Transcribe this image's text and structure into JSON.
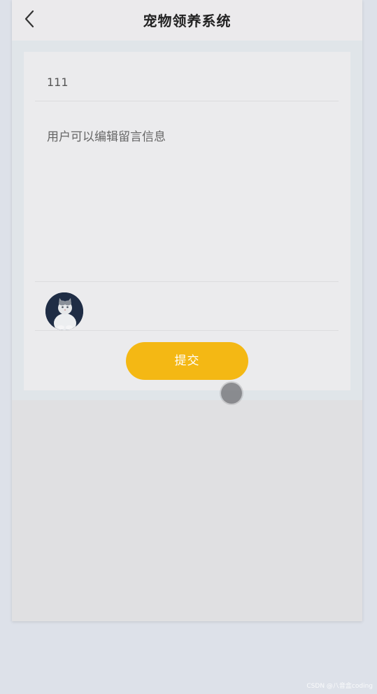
{
  "header": {
    "title": "宠物领养系统",
    "back_icon": "chevron-left-icon"
  },
  "form": {
    "title_value": "111",
    "content_value": "用户可以编辑留言信息",
    "avatar_icon": "cat-avatar-image",
    "submit_label": "提交"
  },
  "colors": {
    "accent": "#f4b814",
    "header_bg": "#ebeaec",
    "card_bg": "#ebebed"
  },
  "watermark": "CSDN @八音盒coding"
}
